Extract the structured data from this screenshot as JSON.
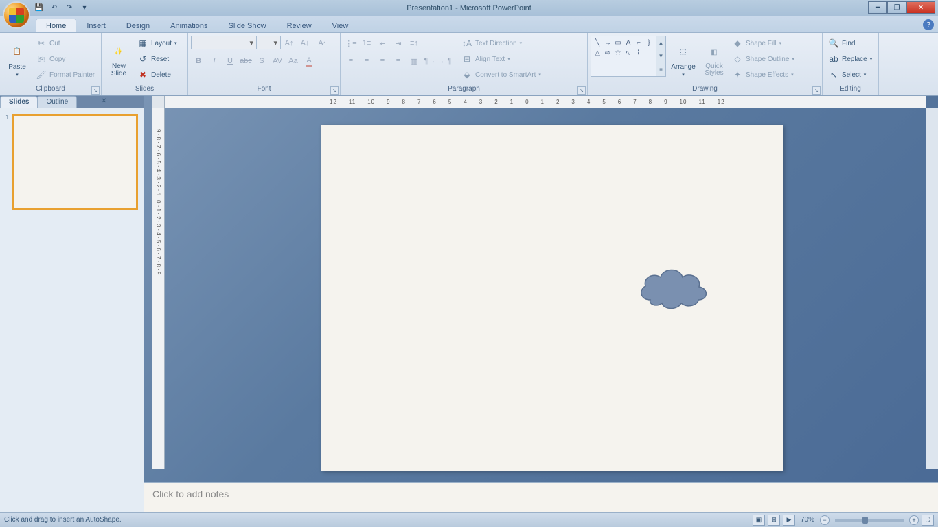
{
  "window": {
    "title": "Presentation1 - Microsoft PowerPoint"
  },
  "tabs": {
    "items": [
      "Home",
      "Insert",
      "Design",
      "Animations",
      "Slide Show",
      "Review",
      "View"
    ],
    "active": "Home"
  },
  "ribbon": {
    "clipboard": {
      "label": "Clipboard",
      "paste": "Paste",
      "cut": "Cut",
      "copy": "Copy",
      "format_painter": "Format Painter"
    },
    "slides": {
      "label": "Slides",
      "new_slide": "New\nSlide",
      "layout": "Layout",
      "reset": "Reset",
      "delete": "Delete"
    },
    "font": {
      "label": "Font"
    },
    "paragraph": {
      "label": "Paragraph",
      "text_direction": "Text Direction",
      "align_text": "Align Text",
      "convert_smartart": "Convert to SmartArt"
    },
    "drawing": {
      "label": "Drawing",
      "arrange": "Arrange",
      "quick_styles": "Quick\nStyles",
      "shape_fill": "Shape Fill",
      "shape_outline": "Shape Outline",
      "shape_effects": "Shape Effects"
    },
    "editing": {
      "label": "Editing",
      "find": "Find",
      "replace": "Replace",
      "select": "Select"
    }
  },
  "side_panel": {
    "tabs": [
      "Slides",
      "Outline"
    ],
    "active_tab": "Slides",
    "slide_number": "1"
  },
  "notes": {
    "placeholder": "Click to add notes"
  },
  "statusbar": {
    "message": "Click and drag to insert an AutoShape.",
    "zoom": "70%"
  },
  "ruler_h": "12 · · 11 · · 10 · · 9 · · 8 · · 7 · · 6 · · 5 · · 4 · · 3 · · 2 · · 1 · · 0 · · 1 · · 2 · · 3 · · 4 · · 5 · · 6 · · 7 · · 8 · · 9 · · 10 · · 11 · · 12",
  "ruler_v": "9 · 8 · 7 · 6 · 5 · 4 · 3 · 2 · 1 · 0 · 1 · 2 · 3 · 4 · 5 · 6 · 7 · 8 · 9"
}
